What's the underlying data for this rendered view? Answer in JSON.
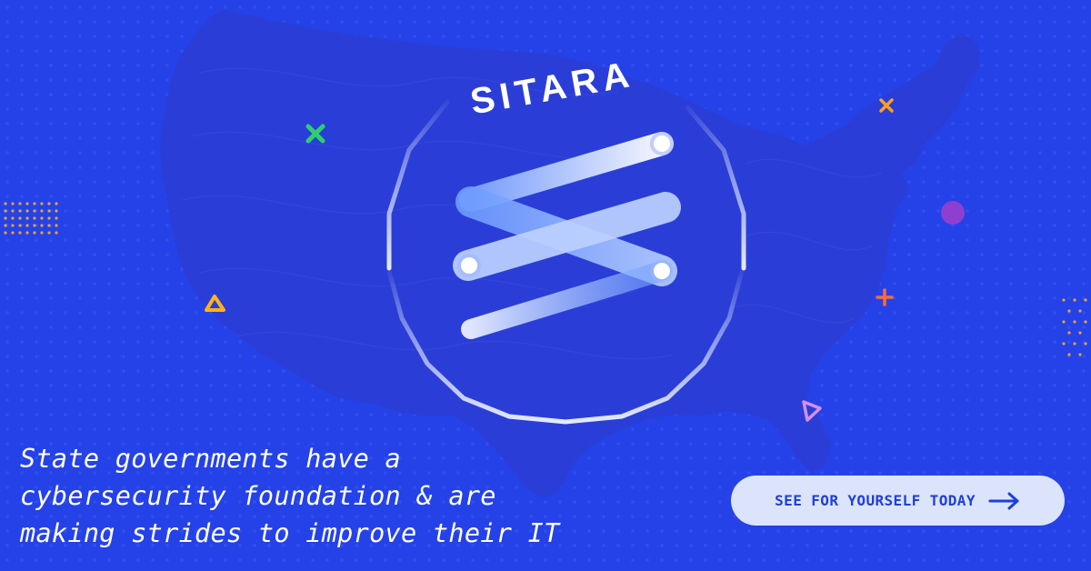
{
  "brand": {
    "name": "SITARA"
  },
  "headline": {
    "lines": [
      "State governments have a",
      "cybersecurity foundation & are",
      "making strides to improve their IT"
    ]
  },
  "cta": {
    "label": "SEE FOR YOURSELF TODAY",
    "icon": "arrow-right-icon"
  },
  "colors": {
    "background": "#2442e8",
    "map": "#2a3fd8",
    "cta_background": "#dbe4fb",
    "cta_text": "#1f3fd8",
    "accent_green": "#2ed06e",
    "accent_orange": "#ff9f1c",
    "accent_coral": "#ff6a3d",
    "accent_purple": "#8e3fd0",
    "accent_pink": "#d58ee8"
  },
  "decorations": [
    {
      "icon": "green-x-icon"
    },
    {
      "icon": "orange-x-icon"
    },
    {
      "icon": "purple-dot-icon"
    },
    {
      "icon": "orange-plus-icon"
    },
    {
      "icon": "yellow-triangle-icon"
    },
    {
      "icon": "pink-triangle-icon"
    },
    {
      "icon": "dot-grid-icon"
    }
  ]
}
